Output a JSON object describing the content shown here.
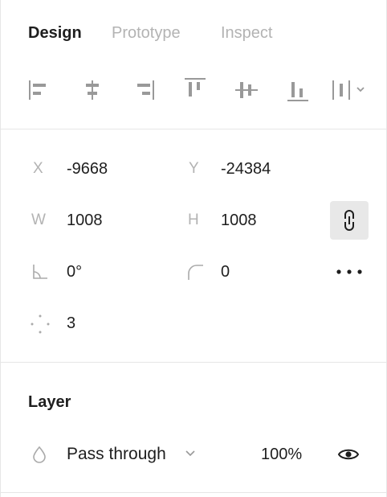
{
  "tabs": [
    {
      "label": "Design",
      "active": true
    },
    {
      "label": "Prototype",
      "active": false
    },
    {
      "label": "Inspect",
      "active": false
    }
  ],
  "align_tools": [
    {
      "icon": "align-left-icon"
    },
    {
      "icon": "align-horizontal-center-icon"
    },
    {
      "icon": "align-right-icon"
    },
    {
      "icon": "align-top-icon"
    },
    {
      "icon": "align-vertical-center-icon"
    },
    {
      "icon": "align-bottom-icon"
    },
    {
      "icon": "distribute-icon"
    }
  ],
  "properties": {
    "x": {
      "label": "X",
      "value": "-9668"
    },
    "y": {
      "label": "Y",
      "value": "-24384"
    },
    "w": {
      "label": "W",
      "value": "1008"
    },
    "h": {
      "label": "H",
      "value": "1008"
    },
    "rotation": {
      "icon": "rotation-icon",
      "value": "0°"
    },
    "radius": {
      "icon": "corner-radius-icon",
      "value": "0"
    },
    "points": {
      "icon": "polygon-points-icon",
      "value": "3"
    },
    "constrain_proportions": {
      "icon": "link-icon",
      "active": true
    }
  },
  "layer": {
    "title": "Layer",
    "blend_mode": "Pass through",
    "opacity": "100%",
    "visible": true
  },
  "colors": {
    "text": "#1e1e1e",
    "muted": "#b3b3b3",
    "divider": "#e6e6e6",
    "active_bg": "#e8e8e8"
  }
}
